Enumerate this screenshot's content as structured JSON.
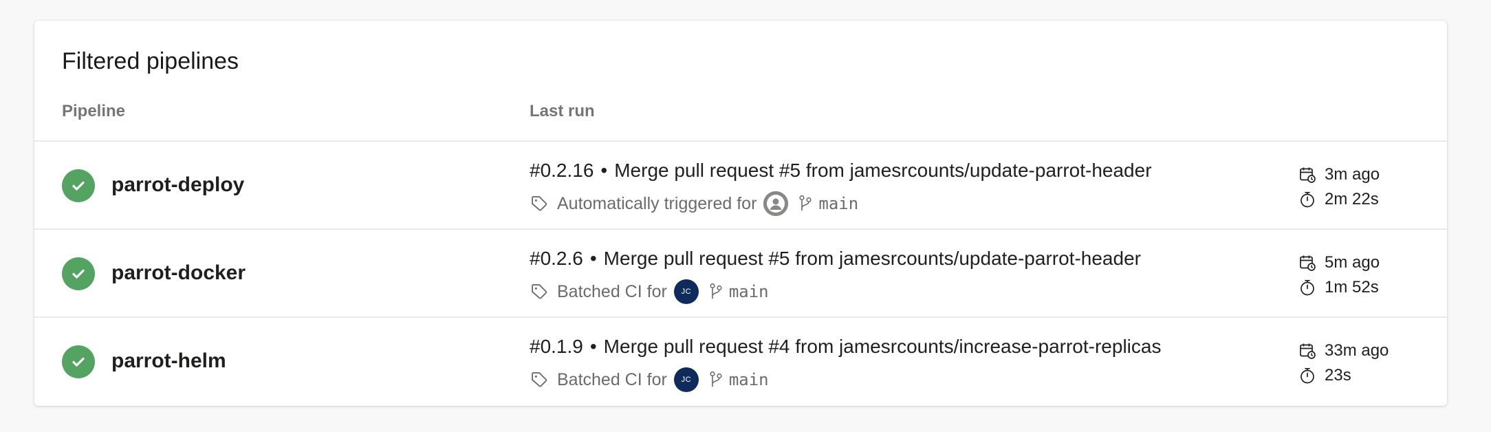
{
  "panel": {
    "title": "Filtered pipelines",
    "col_pipeline": "Pipeline",
    "col_last_run": "Last run"
  },
  "pipelines": [
    {
      "name": "parrot-deploy",
      "status": "succeeded",
      "run_number": "#0.2.16",
      "commit_message": "Merge pull request #5 from jamesrcounts/update-parrot-header",
      "trigger_text": "Automatically triggered for",
      "avatar": "generic-user",
      "avatar_initials": "",
      "branch": "main",
      "started": "3m ago",
      "duration": "2m 22s"
    },
    {
      "name": "parrot-docker",
      "status": "succeeded",
      "run_number": "#0.2.6",
      "commit_message": "Merge pull request #5 from jamesrcounts/update-parrot-header",
      "trigger_text": "Batched CI for",
      "avatar": "initials",
      "avatar_initials": "JC",
      "branch": "main",
      "started": "5m ago",
      "duration": "1m 52s"
    },
    {
      "name": "parrot-helm",
      "status": "succeeded",
      "run_number": "#0.1.9",
      "commit_message": "Merge pull request #4 from jamesrcounts/increase-parrot-replicas",
      "trigger_text": "Batched CI for",
      "avatar": "initials",
      "avatar_initials": "JC",
      "branch": "main",
      "started": "33m ago",
      "duration": "23s"
    }
  ],
  "separator": "•",
  "colors": {
    "success": "#55a362",
    "avatar_jc": "#0f2b5b",
    "avatar_generic": "#8a8886"
  },
  "icons": [
    "check-icon",
    "tag-icon",
    "branch-icon",
    "calendar-clock-icon",
    "stopwatch-icon",
    "user-icon"
  ]
}
